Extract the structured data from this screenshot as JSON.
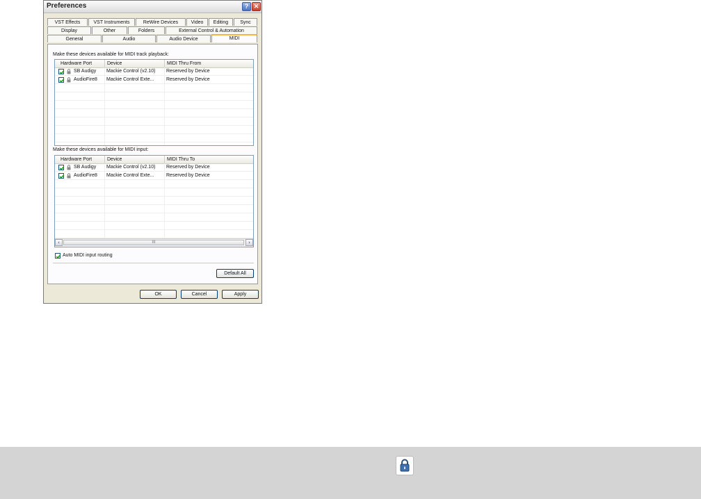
{
  "window": {
    "title": "Preferences"
  },
  "tabs_row1": [
    "VST Effects",
    "VST Instruments",
    "ReWire Devices",
    "Video",
    "Editing",
    "Sync"
  ],
  "tabs_row2": [
    "Display",
    "Other",
    "Folders",
    "External Control & Automation"
  ],
  "tabs_row3": [
    "General",
    "Audio",
    "Audio Device",
    "MIDI"
  ],
  "active_tab": "MIDI",
  "playback": {
    "label": "Make these devices available for MIDI track playback:",
    "columns": [
      "Hardware Port",
      "Device",
      "MIDI Thru From"
    ],
    "rows": [
      {
        "port": "SB Audigy",
        "device": "Mackie Control (v2.10)",
        "thru": "Reserved by Device",
        "checked": true
      },
      {
        "port": "AudioFire8",
        "device": "Mackie Control Exte...",
        "thru": "Reserved by Device",
        "checked": true
      }
    ]
  },
  "input": {
    "label": "Make these devices available for MIDI input:",
    "columns": [
      "Hardware Port",
      "Device",
      "MIDI Thru To"
    ],
    "rows": [
      {
        "port": "SB Audigy",
        "device": "Mackie Control (v2.10)",
        "thru": "Reserved by Device",
        "checked": true
      },
      {
        "port": "AudioFire8",
        "device": "Mackie Control Exte...",
        "thru": "Reserved by Device",
        "checked": true
      }
    ],
    "scroll_thumb_grip": "III"
  },
  "auto_midi": {
    "label": "Auto MIDI input routing",
    "checked": true
  },
  "buttons": {
    "default_all": "Default All",
    "ok": "OK",
    "cancel": "Cancel",
    "apply": "Apply",
    "help": "?",
    "close": "✕"
  },
  "scroll_icons": {
    "left": "‹",
    "right": "›"
  },
  "icons": {
    "checkbox": "check-icon",
    "device": "lock-icon",
    "bottom": "lock-icon"
  },
  "colors": {
    "active_tab_accent": "#f4b342",
    "window_bg": "#ece9d8",
    "list_border": "#7f9db9",
    "check": "#21a121",
    "bottom_bar": "#d4d4d4"
  }
}
